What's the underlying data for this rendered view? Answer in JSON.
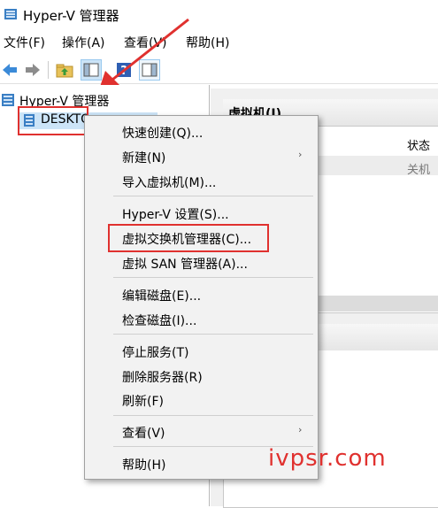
{
  "window": {
    "title": "Hyper-V 管理器",
    "icon": "hyperv-app-icon"
  },
  "menubar": {
    "items": [
      "文件(F)",
      "操作(A)",
      "查看(V)",
      "帮助(H)"
    ]
  },
  "toolbar": {
    "buttons": [
      "back-arrow-icon",
      "forward-arrow-icon",
      "up-folder-icon",
      "show-hide-tree-icon",
      "help-icon",
      "show-hide-action-pane-icon"
    ]
  },
  "tree": {
    "root": "Hyper-V 管理器",
    "host": "DESKTO"
  },
  "right_pane": {
    "vm_header": "虚拟机(I)",
    "col_status": "状态",
    "row_status": "关机"
  },
  "context_menu": {
    "items": [
      "快速创建(Q)...",
      "新建(N)",
      "导入虚拟机(M)...",
      "Hyper-V 设置(S)...",
      "虚拟交换机管理器(C)...",
      "虚拟 SAN 管理器(A)...",
      "编辑磁盘(E)...",
      "检查磁盘(I)...",
      "停止服务(T)",
      "删除服务器(R)",
      "刷新(F)",
      "查看(V)",
      "帮助(H)"
    ],
    "submenu_arrow": "›"
  },
  "watermark": "ivpsr.com",
  "colors": {
    "annotation_red": "#e0312f",
    "selection_blue": "#cce4f7",
    "menu_bg": "#f2f2f2"
  }
}
